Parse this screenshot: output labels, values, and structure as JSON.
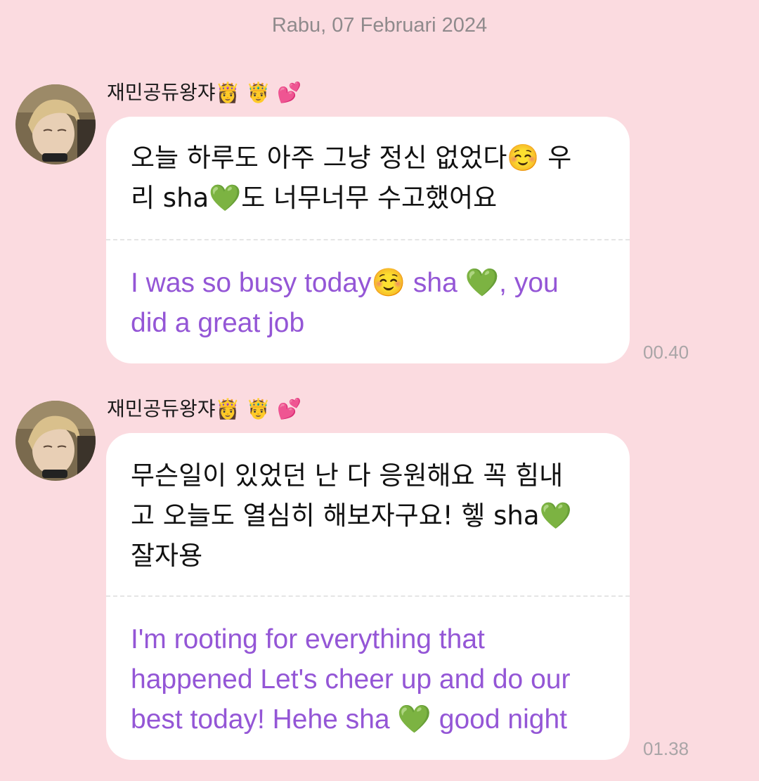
{
  "date_header": "Rabu, 07 Februari 2024",
  "messages": [
    {
      "sender": "재민공듀왕쟈👸 🤴 💕",
      "original": "오늘 하루도 아주 그냥 정신 없었다☺️ 우\n리 sha💚도 너무너무 수고했어요",
      "translated": "I was so busy today☺️ sha 💚, you\ndid a great job",
      "time": "00.40"
    },
    {
      "sender": "재민공듀왕쟈👸 🤴 💕",
      "original": "무슨일이 있었던 난 다 응원해요 꼭 힘내\n고 오늘도 열심히 해보자구요! 헿 sha💚\n잘자용",
      "translated": "I'm rooting for everything that\nhappened Let's cheer up and do our\nbest today! Hehe sha 💚 good night",
      "time": "01.38"
    }
  ],
  "colors": {
    "background": "#fbdbe0",
    "bubble": "#ffffff",
    "translated_text": "#9456d6",
    "time_text": "#a9a5a7",
    "date_text": "#8f8a8c"
  }
}
